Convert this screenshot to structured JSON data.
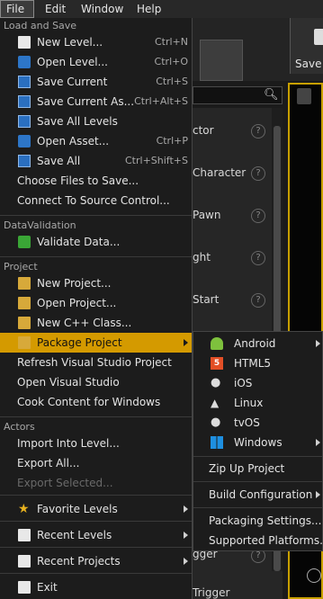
{
  "menubar": {
    "items": [
      "File",
      "Edit",
      "Window",
      "Help"
    ]
  },
  "background": {
    "save_label": "Save",
    "panel_rows": [
      "ctor",
      "Character",
      "Pawn",
      "ght",
      "Start",
      "gger",
      "Trigger"
    ],
    "help_glyph": "?"
  },
  "file_menu": {
    "sections": {
      "load_save": "Load and Save",
      "data_validation": "DataValidation",
      "project": "Project",
      "actors": "Actors"
    },
    "items": {
      "new_level": {
        "label": "New Level...",
        "shortcut": "Ctrl+N",
        "icon": "new-level-icon"
      },
      "open_level": {
        "label": "Open Level...",
        "shortcut": "Ctrl+O",
        "icon": "open-level-icon"
      },
      "save_current": {
        "label": "Save Current",
        "shortcut": "Ctrl+S",
        "icon": "save-icon"
      },
      "save_current_as": {
        "label": "Save Current As...",
        "shortcut": "Ctrl+Alt+S",
        "icon": "save-as-icon"
      },
      "save_all_levels": {
        "label": "Save All Levels",
        "icon": "save-icon"
      },
      "open_asset": {
        "label": "Open Asset...",
        "shortcut": "Ctrl+P",
        "icon": "open-asset-icon"
      },
      "save_all": {
        "label": "Save All",
        "shortcut": "Ctrl+Shift+S",
        "icon": "save-all-icon"
      },
      "choose_files": {
        "label": "Choose Files to Save..."
      },
      "connect_source": {
        "label": "Connect To Source Control..."
      },
      "validate_data": {
        "label": "Validate Data...",
        "icon": "validate-check-icon"
      },
      "new_project": {
        "label": "New Project...",
        "icon": "new-project-icon"
      },
      "open_project": {
        "label": "Open Project...",
        "icon": "open-project-icon"
      },
      "new_cpp_class": {
        "label": "New C++ Class...",
        "icon": "cpp-class-icon"
      },
      "package_project": {
        "label": "Package Project",
        "icon": "package-icon"
      },
      "refresh_vs": {
        "label": "Refresh Visual Studio Project"
      },
      "open_vs": {
        "label": "Open Visual Studio"
      },
      "cook_content": {
        "label": "Cook Content for Windows"
      },
      "import_into_level": {
        "label": "Import Into Level..."
      },
      "export_all": {
        "label": "Export All..."
      },
      "export_selected": {
        "label": "Export Selected..."
      },
      "favorite_levels": {
        "label": "Favorite Levels",
        "icon": "star-icon"
      },
      "recent_levels": {
        "label": "Recent Levels",
        "icon": "recent-levels-icon"
      },
      "recent_projects": {
        "label": "Recent Projects",
        "icon": "recent-projects-icon"
      },
      "exit": {
        "label": "Exit",
        "icon": "exit-icon"
      }
    }
  },
  "package_submenu": {
    "platforms": [
      {
        "label": "Android",
        "icon": "android-icon",
        "has_submenu": true
      },
      {
        "label": "HTML5",
        "icon": "html5-icon",
        "has_submenu": false
      },
      {
        "label": "iOS",
        "icon": "apple-icon",
        "has_submenu": false
      },
      {
        "label": "Linux",
        "icon": "linux-icon",
        "has_submenu": false
      },
      {
        "label": "tvOS",
        "icon": "apple-tv-icon",
        "has_submenu": false
      },
      {
        "label": "Windows",
        "icon": "windows-icon",
        "has_submenu": true
      }
    ],
    "zip_up_project": "Zip Up Project",
    "build_configuration": "Build Configuration",
    "packaging_settings": "Packaging Settings...",
    "supported_platforms": "Supported Platforms..."
  },
  "colors": {
    "highlight": "#d49a00",
    "menu_bg": "#1c1c1c",
    "viewport_border": "#c8a000"
  }
}
